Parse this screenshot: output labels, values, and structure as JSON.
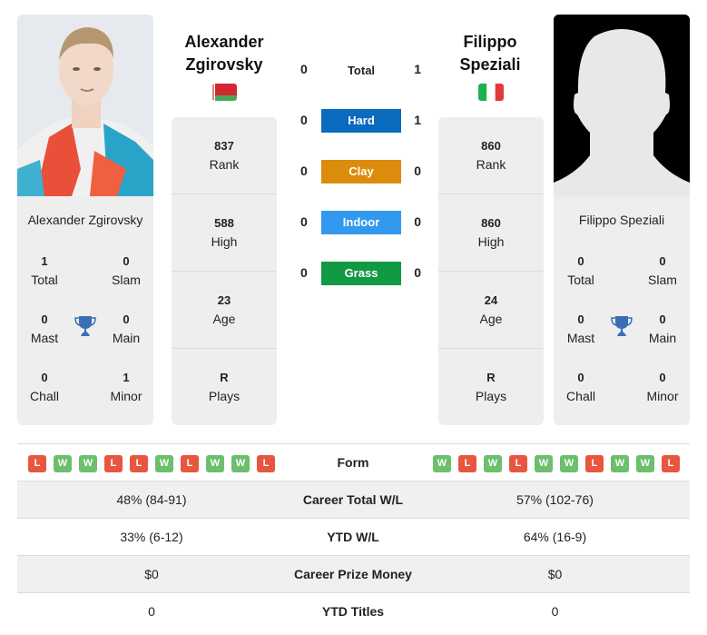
{
  "player_left": {
    "name": "Alexander Zgirovsky",
    "name_line1": "Alexander",
    "name_line2": "Zgirovsky",
    "country": "Belarus",
    "flag_colors": {
      "top": "#d22730",
      "bottom": "#4aa657",
      "hoist": "#ffffff"
    },
    "stats": [
      {
        "value": "837",
        "label": "Rank"
      },
      {
        "value": "588",
        "label": "High"
      },
      {
        "value": "23",
        "label": "Age"
      },
      {
        "value": "R",
        "label": "Plays"
      }
    ],
    "titles": [
      {
        "value": "1",
        "label": "Total"
      },
      {
        "value": "0",
        "label": "Slam"
      },
      {
        "value": "0",
        "label": "Mast"
      },
      {
        "value": "0",
        "label": "Main"
      },
      {
        "value": "0",
        "label": "Chall"
      },
      {
        "value": "1",
        "label": "Minor"
      }
    ],
    "form": [
      "L",
      "W",
      "W",
      "L",
      "L",
      "W",
      "L",
      "W",
      "W",
      "L"
    ]
  },
  "player_right": {
    "name": "Filippo Speziali",
    "name_line1": "Filippo",
    "name_line2": "Speziali",
    "country": "Italy",
    "flag_colors": {
      "left": "#1eb04b",
      "middle": "#ffffff",
      "right": "#e0393e"
    },
    "stats": [
      {
        "value": "860",
        "label": "Rank"
      },
      {
        "value": "860",
        "label": "High"
      },
      {
        "value": "24",
        "label": "Age"
      },
      {
        "value": "R",
        "label": "Plays"
      }
    ],
    "titles": [
      {
        "value": "0",
        "label": "Total"
      },
      {
        "value": "0",
        "label": "Slam"
      },
      {
        "value": "0",
        "label": "Mast"
      },
      {
        "value": "0",
        "label": "Main"
      },
      {
        "value": "0",
        "label": "Chall"
      },
      {
        "value": "0",
        "label": "Minor"
      }
    ],
    "form": [
      "W",
      "L",
      "W",
      "L",
      "W",
      "W",
      "L",
      "W",
      "W",
      "L"
    ]
  },
  "h2h": {
    "total": {
      "label": "Total",
      "left": "0",
      "right": "1"
    },
    "surfaces": [
      {
        "label": "Hard",
        "left": "0",
        "right": "1",
        "color": "#0b6bbf"
      },
      {
        "label": "Clay",
        "left": "0",
        "right": "0",
        "color": "#dc8c0c"
      },
      {
        "label": "Indoor",
        "left": "0",
        "right": "0",
        "color": "#3399ee"
      },
      {
        "label": "Grass",
        "left": "0",
        "right": "0",
        "color": "#119944"
      }
    ]
  },
  "comparison": {
    "form_label": "Form",
    "rows": [
      {
        "label": "Career Total W/L",
        "left": "48% (84-91)",
        "right": "57% (102-76)"
      },
      {
        "label": "YTD W/L",
        "left": "33% (6-12)",
        "right": "64% (16-9)"
      },
      {
        "label": "Career Prize Money",
        "left": "$0",
        "right": "$0"
      },
      {
        "label": "YTD Titles",
        "left": "0",
        "right": "0"
      }
    ]
  },
  "colors": {
    "win": "#6cbf6c",
    "loss": "#e8563f",
    "trophy": "#3a6fb8",
    "card_bg": "#eeeeee"
  }
}
